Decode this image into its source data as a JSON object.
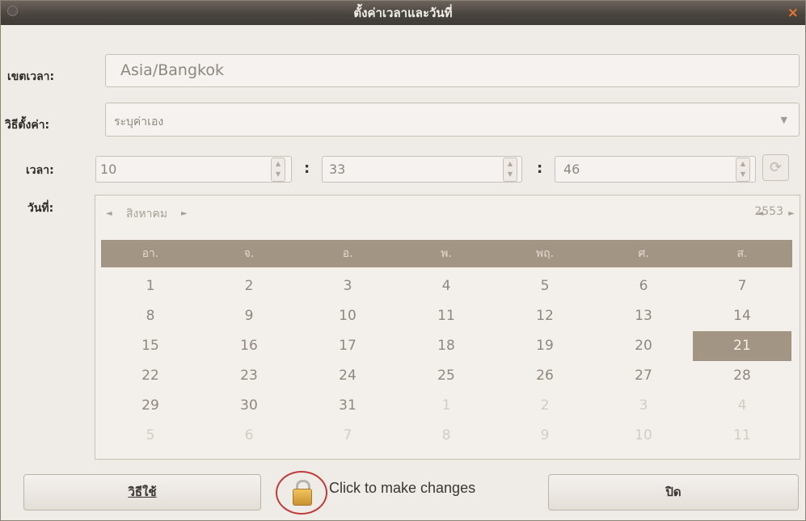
{
  "window": {
    "title": "ตั้งค่าเวลาและวันที่",
    "close_glyph": "×"
  },
  "timezone": {
    "label": "เขตเวลา:",
    "value": "Asia/Bangkok"
  },
  "method": {
    "label": "วิธีตั้งค่า:",
    "value": "ระบุค่าเอง",
    "arrow": "▼"
  },
  "time": {
    "label": "เวลา:",
    "hour": "10",
    "minute": "33",
    "second": "46",
    "separator": ":"
  },
  "date": {
    "label": "วันที่:",
    "month": "สิงหาคม",
    "year": "2553",
    "prev_glyph": "◄",
    "next_glyph": "►",
    "weekdays": [
      "อา.",
      "จ.",
      "อ.",
      "พ.",
      "พฤ.",
      "ศ.",
      "ส."
    ],
    "days": [
      "1",
      "2",
      "3",
      "4",
      "5",
      "6",
      "7",
      "8",
      "9",
      "10",
      "11",
      "12",
      "13",
      "14",
      "15",
      "16",
      "17",
      "18",
      "19",
      "20",
      "21",
      "22",
      "23",
      "24",
      "25",
      "26",
      "27",
      "28",
      "29",
      "30",
      "31",
      "1",
      "2",
      "3",
      "4",
      "5",
      "6",
      "7",
      "8",
      "9",
      "10",
      "11"
    ],
    "selected_day": "21"
  },
  "footer": {
    "help_label": "วิธีใช้",
    "lock_text": "Click to make changes",
    "close_label": "ปิด"
  },
  "colors": {
    "accent": "#a39584",
    "title_bar": "#4a453f",
    "close_x": "#e8772e",
    "lock_circle": "#c23b3b"
  },
  "icons": {
    "lock": "lock-icon",
    "refresh": "refresh-icon"
  }
}
